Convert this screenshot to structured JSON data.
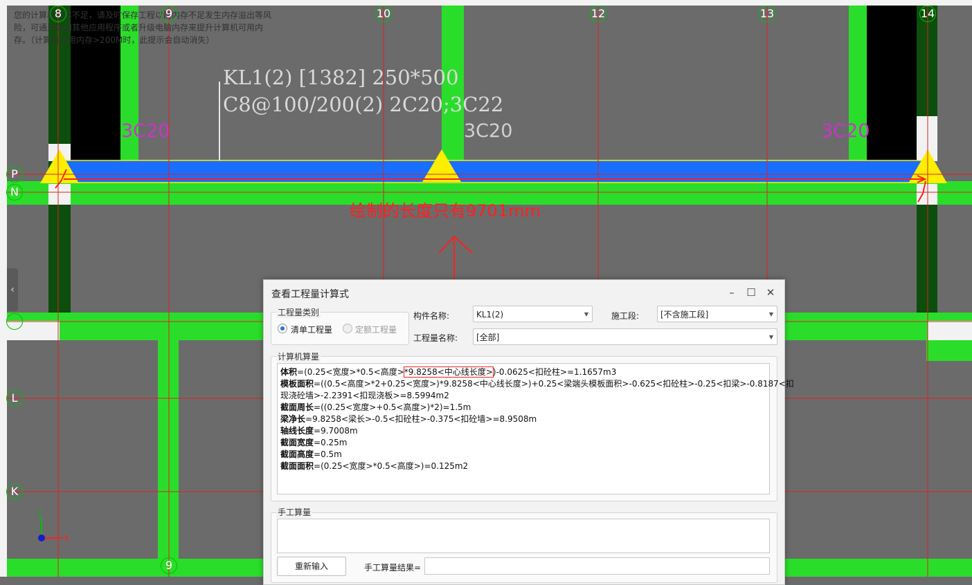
{
  "warning": "您的计算机内存不足，请及时保存工程以防内存不足发生内存溢出等风险，可通过关闭其他应用程序或者升级电脑内存来提升计算机可用内存。（计算机可用内存>200M时，此提示会自动消失）",
  "axes": {
    "top": [
      "8",
      "9",
      "10",
      "12",
      "13",
      "14"
    ],
    "left": [
      "P",
      "N",
      "L",
      "K"
    ],
    "bottom": [
      "9"
    ]
  },
  "beam": {
    "label_line1": "KL1(2) [1382] 250*500",
    "label_line2": "C8@100/200(2) 2C20;3C22",
    "rebar_left": "3C20",
    "rebar_mid": "3C20",
    "rebar_right": "3C20"
  },
  "annotation": "绘制的长度只有9701mm",
  "colors": {
    "beam": "#1a6eff",
    "column": "#2bdd2b",
    "support": "#ffee00",
    "markup": "#ff2020"
  },
  "dialog": {
    "title": "查看工程量计算式",
    "category_group": "工程量类别",
    "radio_qingdan": "清单工程量",
    "radio_dinge": "定额工程量",
    "component_label": "构件名称:",
    "component_value": "KL1(2)",
    "section_label": "施工段:",
    "section_value": "[不含施工段]",
    "quantity_label": "工程量名称:",
    "quantity_value": "[全部]",
    "computer_group": "计算机算量",
    "formulas": [
      {
        "name": "体积",
        "expr_a": "=(0.25<宽度>*0.5<高度>",
        "expr_hl": "*9.8258<中心线长度>",
        "expr_b": ")-0.0625<扣砼柱>=1.1657m3"
      },
      {
        "name": "模板面积",
        "expr": "=((0.5<高度>*2+0.25<宽度>)*9.8258<中心线长度>)+0.25<梁端头模板面积>-0.625<扣砼柱>-0.25<扣梁>-0.8187<扣"
      },
      {
        "name": "",
        "expr": "现浇砼墙>-2.2391<扣现浇板>=8.5994m2"
      },
      {
        "name": "截面周长",
        "expr": "=((0.25<宽度>+0.5<高度>)*2)=1.5m"
      },
      {
        "name": "梁净长",
        "expr": "=9.8258<梁长>-0.5<扣砼柱>-0.375<扣砼墙>=8.9508m"
      },
      {
        "name": "轴线长度",
        "expr": "=9.7008m"
      },
      {
        "name": "截面宽度",
        "expr": "=0.25m"
      },
      {
        "name": "截面高度",
        "expr": "=0.5m"
      },
      {
        "name": "截面面积",
        "expr": "=(0.25<宽度>*0.5<高度>)=0.125m2"
      }
    ],
    "manual_group": "手工算量",
    "reinput_button": "重新输入",
    "manual_result_label": "手工算量结果="
  },
  "coord": {
    "x": "X",
    "y": "Y"
  }
}
